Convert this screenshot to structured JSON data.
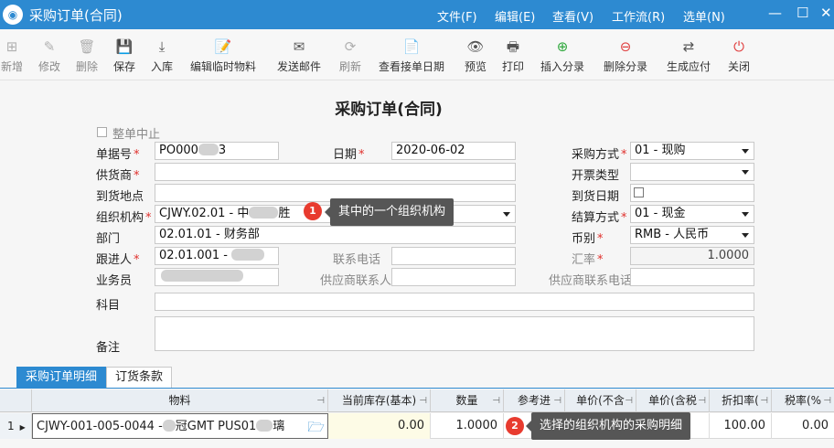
{
  "window": {
    "title": "采购订单(合同)",
    "menus": [
      "文件(F)",
      "编辑(E)",
      "查看(V)",
      "工作流(R)",
      "选单(N)"
    ],
    "win_buttons": [
      "—",
      "☐",
      "✕"
    ]
  },
  "toolbar": [
    {
      "label": "新增",
      "icon": "plus-doc-icon",
      "glyph": "⊞",
      "state": "disabled"
    },
    {
      "label": "修改",
      "icon": "edit-icon",
      "glyph": "✎",
      "state": "disabled"
    },
    {
      "label": "删除",
      "icon": "trash-icon",
      "glyph": "🗑",
      "state": "disabled"
    },
    {
      "label": "保存",
      "icon": "save-icon",
      "glyph": "💾",
      "state": "normal"
    },
    {
      "label": "入库",
      "icon": "inbound-icon",
      "glyph": "⤓",
      "state": "normal"
    },
    {
      "label": "编辑临时物料",
      "icon": "edit-material-icon",
      "glyph": "📝",
      "state": "normal"
    },
    {
      "label": "发送邮件",
      "icon": "mail-icon",
      "glyph": "✉",
      "state": "normal"
    },
    {
      "label": "刷新",
      "icon": "refresh-icon",
      "glyph": "⟳",
      "state": "disabled"
    },
    {
      "label": "查看接单日期",
      "icon": "view-date-icon",
      "glyph": "📄",
      "state": "normal"
    },
    {
      "label": "预览",
      "icon": "preview-eye-icon",
      "glyph": "👁",
      "state": "normal"
    },
    {
      "label": "打印",
      "icon": "printer-icon",
      "glyph": "🖶",
      "state": "normal"
    },
    {
      "label": "插入分录",
      "icon": "insert-row-icon",
      "glyph": "⊕",
      "state": "green"
    },
    {
      "label": "删除分录",
      "icon": "delete-row-icon",
      "glyph": "⊖",
      "state": "red"
    },
    {
      "label": "生成应付",
      "icon": "generate-payable-icon",
      "glyph": "⇄",
      "state": "normal"
    },
    {
      "label": "关闭",
      "icon": "power-icon",
      "glyph": "⏻",
      "state": "red"
    }
  ],
  "form": {
    "title": "采购订单(合同)",
    "stop_all_label": "整单中止",
    "fields": {
      "bill_no": {
        "label": "单据号",
        "value": "PO000",
        "value_suffix": "3"
      },
      "date": {
        "label": "日期",
        "value": "2020-06-02"
      },
      "purchase_method": {
        "label": "采购方式",
        "value": "01 - 现购"
      },
      "supplier": {
        "label": "供货商",
        "value": ""
      },
      "invoice_type": {
        "label": "开票类型",
        "value": ""
      },
      "delivery_place": {
        "label": "到货地点",
        "value": ""
      },
      "arrival_date": {
        "label": "到货日期",
        "value": ""
      },
      "org": {
        "label": "组织机构",
        "value": "CJWY.02.01  - 中",
        "value_suffix": "胜"
      },
      "settlement": {
        "label": "结算方式",
        "value": "01 - 现金"
      },
      "dept": {
        "label": "部门",
        "value": "02.01.01 - 财务部"
      },
      "currency": {
        "label": "币别",
        "value": "RMB - 人民币"
      },
      "follower": {
        "label": "跟进人",
        "value": "02.01.001 - "
      },
      "phone": {
        "label": "联系电话",
        "value": ""
      },
      "rate": {
        "label": "汇率",
        "value": "1.0000"
      },
      "salesman": {
        "label": "业务员",
        "value": ""
      },
      "supplier_contact": {
        "label": "供应商联系人",
        "value": ""
      },
      "supplier_phone": {
        "label": "供应商联系电话",
        "value": ""
      },
      "subject": {
        "label": "科目",
        "value": ""
      },
      "remark": {
        "label": "备注",
        "value": ""
      }
    }
  },
  "annotations": {
    "callout1": {
      "num": "1",
      "text": "其中的一个组织机构"
    },
    "callout2": {
      "num": "2",
      "text": "选择的组织机构的采购明细"
    }
  },
  "tabs": [
    "采购订单明细",
    "订货条款"
  ],
  "grid": {
    "columns": [
      "物料",
      "当前库存(基本)",
      "数量",
      "参考进",
      "单价(不含",
      "单价(含税",
      "折扣率(",
      "税率(%"
    ],
    "rows": [
      {
        "index": "1",
        "material": "CJWY-001-005-0044  -",
        "material_mid": "冠GMT  PUS01",
        "material_tail": "璃",
        "stock": "0.00",
        "qty": "1.0000",
        "discount": "100.00",
        "tax_rate": "0.00"
      }
    ]
  }
}
